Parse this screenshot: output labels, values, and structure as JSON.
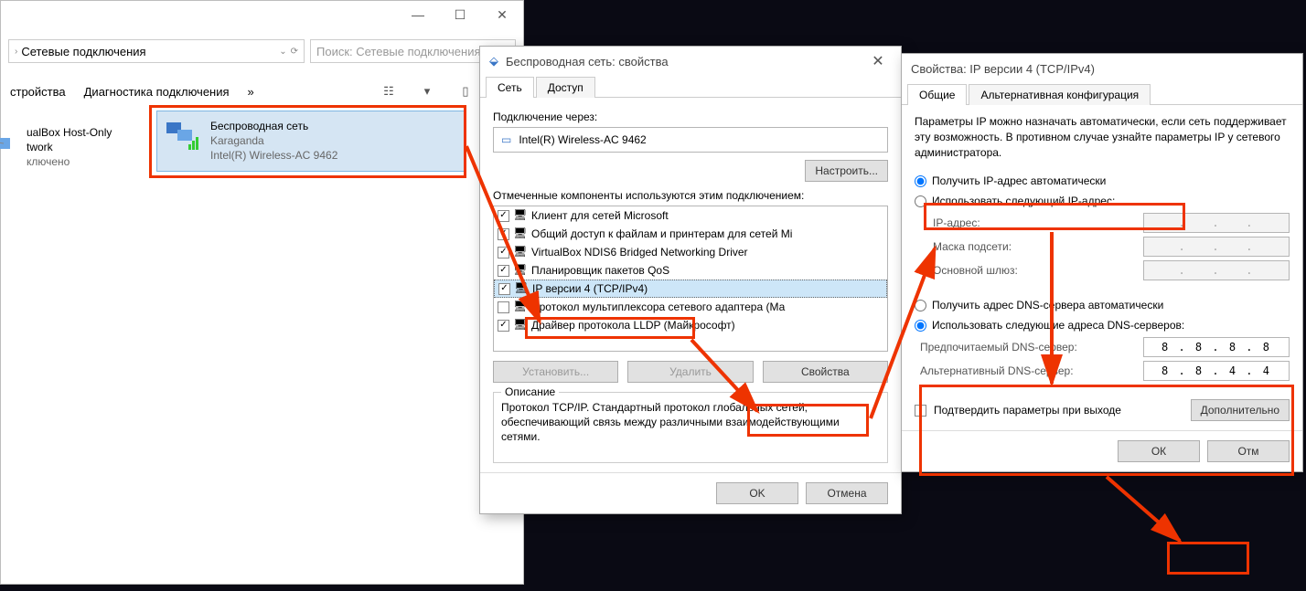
{
  "explorer": {
    "breadcrumb": "Сетевые подключения",
    "search_placeholder": "Поиск: Сетевые подключения",
    "toolbar": {
      "device": "стройства",
      "diagnostics": "Диагностика подключения",
      "more": "»"
    },
    "item_vbox": {
      "name": "ualBox Host-Only",
      "line2": "twork",
      "status": "ключено"
    },
    "item_wireless": {
      "name": "Беспроводная сеть",
      "ssid": "Karaganda",
      "adapter": "Intel(R) Wireless-AC 9462"
    }
  },
  "props_dialog": {
    "title": "Беспроводная сеть: свойства",
    "tab_network": "Сеть",
    "tab_access": "Доступ",
    "connect_via": "Подключение через:",
    "adapter": "Intel(R) Wireless-AC 9462",
    "configure": "Настроить...",
    "components_label": "Отмеченные компоненты используются этим подключением:",
    "components": [
      {
        "checked": true,
        "label": "Клиент для сетей Microsoft"
      },
      {
        "checked": true,
        "label": "Общий доступ к файлам и принтерам для сетей Mi"
      },
      {
        "checked": true,
        "label": "VirtualBox NDIS6 Bridged Networking Driver"
      },
      {
        "checked": true,
        "label": "Планировщик пакетов QoS"
      },
      {
        "checked": true,
        "label": "IP версии 4 (TCP/IPv4)"
      },
      {
        "checked": false,
        "label": "Протокол мультиплексора сетевого адаптера (Ма"
      },
      {
        "checked": true,
        "label": "Драйвер протокола LLDP (Майкрософт)"
      }
    ],
    "btn_install": "Установить...",
    "btn_remove": "Удалить",
    "btn_props": "Свойства",
    "desc_legend": "Описание",
    "desc_text": "Протокол TCP/IP. Стандартный протокол глобальных сетей, обеспечивающий связь между различными взаимодействующими сетями.",
    "ok": "OK",
    "cancel": "Отмена"
  },
  "ipv4_dialog": {
    "title": "Свойства: IP версии 4 (TCP/IPv4)",
    "tab_general": "Общие",
    "tab_alt": "Альтернативная конфигурация",
    "intro": "Параметры IP можно назначать автоматически, если сеть поддерживает эту возможность. В противном случае узнайте параметры IP у сетевого администратора.",
    "radio_auto_ip": "Получить IP-адрес автоматически",
    "radio_manual_ip": "Использовать следующий IP-адрес:",
    "label_ip": "IP-адрес:",
    "label_mask": "Маска подсети:",
    "label_gw": "Основной шлюз:",
    "radio_auto_dns": "Получить адрес DNS-сервера автоматически",
    "radio_manual_dns": "Использовать следующие адреса DNS-серверов:",
    "label_dns1": "Предпочитаемый DNS-сервер:",
    "label_dns2": "Альтернативный DNS-сервер:",
    "dns1": "8 . 8 . 8 . 8",
    "dns2": "8 . 8 . 4 . 4",
    "confirm_exit": "Подтвердить параметры при выходе",
    "btn_advanced": "Дополнительно",
    "ok": "ОК",
    "cancel": "Отм"
  }
}
